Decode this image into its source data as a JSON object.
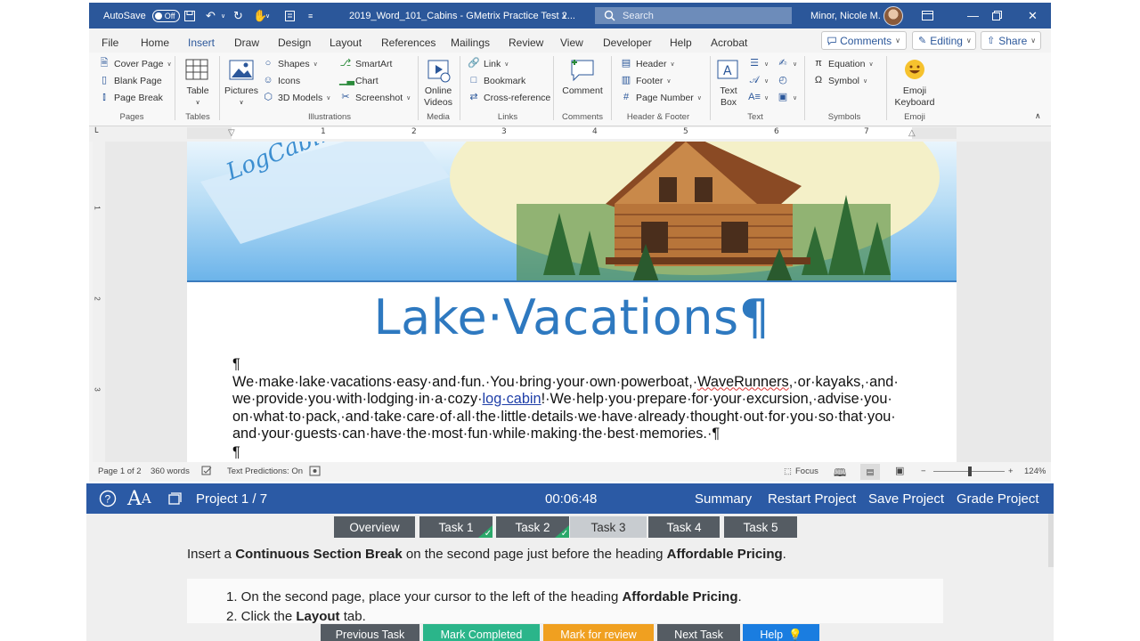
{
  "titlebar": {
    "autosave_label": "AutoSave",
    "autosave_state": "Off",
    "document_title": "2019_Word_101_Cabins  -  GMetrix Practice Test 2...",
    "search_placeholder": "Search",
    "user_name": "Minor, Nicole M."
  },
  "menu": {
    "tabs": [
      "File",
      "Home",
      "Insert",
      "Draw",
      "Design",
      "Layout",
      "References",
      "Mailings",
      "Review",
      "View",
      "Developer",
      "Help",
      "Acrobat"
    ],
    "active_tab": "Insert",
    "comments_label": "Comments",
    "editing_label": "Editing",
    "share_label": "Share"
  },
  "ribbon": {
    "pages": {
      "cover_page": "Cover Page",
      "blank_page": "Blank Page",
      "page_break": "Page Break",
      "label": "Pages"
    },
    "tables": {
      "table": "Table",
      "label": "Tables"
    },
    "illustrations": {
      "pictures": "Pictures",
      "shapes": "Shapes",
      "icons": "Icons",
      "models_3d": "3D Models",
      "smartart": "SmartArt",
      "chart": "Chart",
      "screenshot": "Screenshot",
      "label": "Illustrations"
    },
    "media": {
      "online_videos_1": "Online",
      "online_videos_2": "Videos",
      "label": "Media"
    },
    "links": {
      "link": "Link",
      "bookmark": "Bookmark",
      "cross_reference": "Cross-reference",
      "label": "Links"
    },
    "comments": {
      "comment": "Comment",
      "label": "Comments"
    },
    "header_footer": {
      "header": "Header",
      "footer": "Footer",
      "page_number": "Page Number",
      "label": "Header & Footer"
    },
    "text": {
      "text_box_1": "Text",
      "text_box_2": "Box",
      "label": "Text"
    },
    "symbols": {
      "equation": "Equation",
      "symbol": "Symbol",
      "label": "Symbols"
    },
    "emoji": {
      "emoji_1": "Emoji",
      "emoji_2": "Keyboard",
      "label": "Emoji"
    }
  },
  "ruler": {
    "numbers": [
      "1",
      "2",
      "3",
      "4",
      "5",
      "6",
      "7"
    ]
  },
  "vruler": {
    "numbers": [
      "1",
      "2",
      "3"
    ]
  },
  "document": {
    "banner_text": "LogCabin·Ren",
    "title": "Lake·Vacations¶",
    "para_mark": "¶",
    "line1_a": "We·make·lake·vacations·easy·and·fun.·You·bring·your·own·powerboat,·",
    "line1_squig": "WaveRunners",
    "line1_b": ",·or·kayaks,·and·",
    "line2_a": "we·provide·you·with·lodging·in·a·cozy·",
    "line2_link": "log·cabin",
    "line2_b": "!·We·help·you·prepare·for·your·excursion,·advise·you·",
    "line3": "on·what·to·pack,·and·take·care·of·all·the·little·details·we·have·already·thought·out·for·you·so·that·you·",
    "line4": "and·your·guests·can·have·the·most·fun·while·making·the·best·memories.·¶",
    "para_mark_2": "¶"
  },
  "status": {
    "page": "Page 1 of 2",
    "words": "360 words",
    "predictions": "Text Predictions: On",
    "focus": "Focus",
    "zoom": "124%"
  },
  "gmetrix": {
    "project": "Project 1 / 7",
    "timer": "00:06:48",
    "summary": "Summary",
    "restart": "Restart Project",
    "save": "Save Project",
    "grade": "Grade Project",
    "tabs": [
      "Overview",
      "Task 1",
      "Task 2",
      "Task 3",
      "Task 4",
      "Task 5"
    ],
    "active_tab": "Task 3",
    "task_a": "Insert a ",
    "task_b": "Continuous Section Break",
    "task_c": " on the second page just before the heading ",
    "task_d": "Affordable Pricing",
    "task_e": ".",
    "step1_a": "1. On the second page, place your cursor to the left of the heading ",
    "step1_b": "Affordable Pricing",
    "step1_c": ".",
    "step2_a": "2. Click the ",
    "step2_b": "Layout",
    "step2_c": " tab.",
    "btn_previous": "Previous Task",
    "btn_completed": "Mark Completed",
    "btn_review": "Mark for review",
    "btn_next": "Next Task",
    "btn_help": "Help",
    "colors": {
      "bar": "#2b5aa5",
      "completed": "#2bb58a",
      "review": "#f0a020",
      "help": "#1a7de0",
      "dark": "#555c63"
    }
  }
}
